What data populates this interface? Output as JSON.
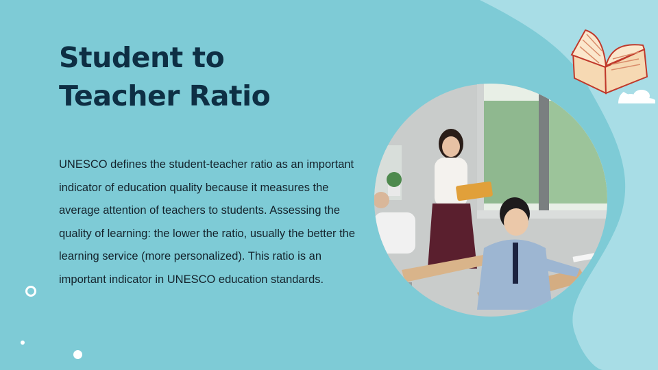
{
  "slide": {
    "title_line1": "Student to",
    "title_line2": "Teacher Ratio",
    "paragraph": "UNESCO defines the student-teacher ratio as an important indicator of education quality because it measures the average attention of teachers to students. Assessing the quality of learning: the lower the ratio, usually the better the learning service (more personalized). This ratio is an important indicator in UNESCO education standards."
  },
  "theme": {
    "background": "#7ECBD6",
    "accent_light": "#A8DDE6",
    "title_color": "#0E2F44",
    "text_color": "#14232C"
  },
  "icons": [
    "open-book-icon",
    "cloud-icon"
  ]
}
